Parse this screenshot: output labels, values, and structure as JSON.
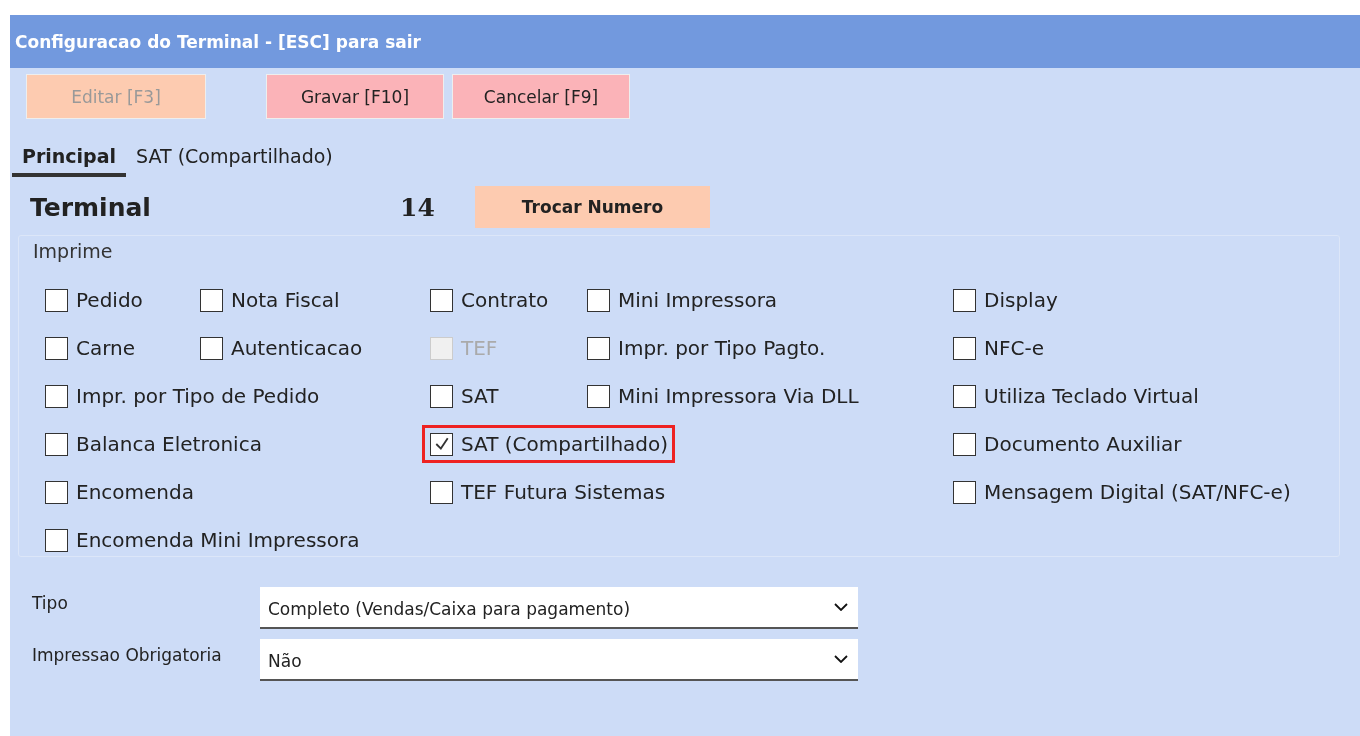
{
  "window": {
    "title": "Configuracao do Terminal - [ESC] para sair"
  },
  "toolbar": [
    {
      "label": "Editar [F3]",
      "kind": "edit",
      "disabled": true
    },
    {
      "label": "Gravar [F10]",
      "kind": "save",
      "disabled": false
    },
    {
      "label": "Cancelar [F9]",
      "kind": "cancel",
      "disabled": false
    }
  ],
  "tabs": [
    {
      "label": "Principal",
      "selected": true
    },
    {
      "label": "SAT (Compartilhado)",
      "selected": false
    }
  ],
  "terminal": {
    "label": "Terminal",
    "number": "14",
    "button": "Trocar Numero"
  },
  "imprime": {
    "legend": "Imprime",
    "columns": [
      {
        "items": [
          {
            "label": "Pedido",
            "checked": false,
            "disabled": false,
            "highlighted": false
          },
          {
            "label": "Carne",
            "checked": false,
            "disabled": false,
            "highlighted": false
          },
          {
            "label": "Impr. por Tipo de Pedido",
            "checked": false,
            "disabled": false,
            "highlighted": false
          },
          {
            "label": "Balanca Eletronica",
            "checked": false,
            "disabled": false,
            "highlighted": false
          },
          {
            "label": "Encomenda",
            "checked": false,
            "disabled": false,
            "highlighted": false
          },
          {
            "label": "Encomenda Mini Impressora",
            "checked": false,
            "disabled": false,
            "highlighted": false
          }
        ]
      },
      {
        "items": [
          {
            "label": "Nota Fiscal",
            "checked": false,
            "disabled": false,
            "highlighted": false
          },
          {
            "label": "Autenticacao",
            "checked": false,
            "disabled": false,
            "highlighted": false
          }
        ]
      },
      {
        "items": [
          {
            "label": "Contrato",
            "checked": false,
            "disabled": false,
            "highlighted": false
          },
          {
            "label": "TEF",
            "checked": false,
            "disabled": true,
            "highlighted": false
          },
          {
            "label": "SAT",
            "checked": false,
            "disabled": false,
            "highlighted": false
          },
          {
            "label": "SAT (Compartilhado)",
            "checked": true,
            "disabled": false,
            "highlighted": true
          },
          {
            "label": "TEF Futura Sistemas",
            "checked": false,
            "disabled": false,
            "highlighted": false
          }
        ]
      },
      {
        "items": [
          {
            "label": "Mini Impressora",
            "checked": false,
            "disabled": false,
            "highlighted": false
          },
          {
            "label": "Impr. por Tipo Pagto.",
            "checked": false,
            "disabled": false,
            "highlighted": false
          },
          {
            "label": "Mini Impressora Via DLL",
            "checked": false,
            "disabled": false,
            "highlighted": false
          }
        ]
      },
      {
        "items": [
          {
            "label": "Display",
            "checked": false,
            "disabled": false,
            "highlighted": false
          },
          {
            "label": "NFC-e",
            "checked": false,
            "disabled": false,
            "highlighted": false
          },
          {
            "label": "Utiliza Teclado Virtual",
            "checked": false,
            "disabled": false,
            "highlighted": false
          },
          {
            "label": "Documento Auxiliar",
            "checked": false,
            "disabled": false,
            "highlighted": false
          },
          {
            "label": "Mensagem Digital (SAT/NFC-e)",
            "checked": false,
            "disabled": false,
            "highlighted": false
          }
        ]
      }
    ]
  },
  "fields": [
    {
      "label": "Tipo",
      "value": "Completo (Vendas/Caixa para pagamento)"
    },
    {
      "label": "Impressao Obrigatoria",
      "value": "Não"
    }
  ]
}
